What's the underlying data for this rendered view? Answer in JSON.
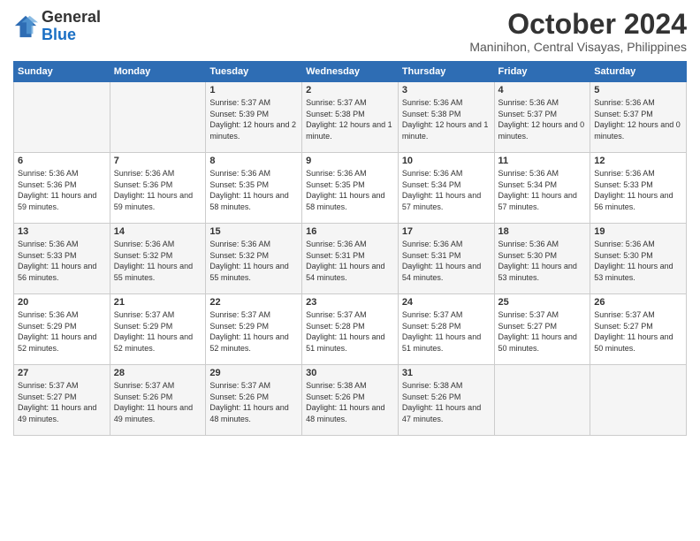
{
  "logo": {
    "line1": "General",
    "line2": "Blue"
  },
  "header": {
    "month": "October 2024",
    "location": "Maninihon, Central Visayas, Philippines"
  },
  "weekdays": [
    "Sunday",
    "Monday",
    "Tuesday",
    "Wednesday",
    "Thursday",
    "Friday",
    "Saturday"
  ],
  "weeks": [
    [
      {
        "day": "",
        "sunrise": "",
        "sunset": "",
        "daylight": ""
      },
      {
        "day": "",
        "sunrise": "",
        "sunset": "",
        "daylight": ""
      },
      {
        "day": "1",
        "sunrise": "Sunrise: 5:37 AM",
        "sunset": "Sunset: 5:39 PM",
        "daylight": "Daylight: 12 hours and 2 minutes."
      },
      {
        "day": "2",
        "sunrise": "Sunrise: 5:37 AM",
        "sunset": "Sunset: 5:38 PM",
        "daylight": "Daylight: 12 hours and 1 minute."
      },
      {
        "day": "3",
        "sunrise": "Sunrise: 5:36 AM",
        "sunset": "Sunset: 5:38 PM",
        "daylight": "Daylight: 12 hours and 1 minute."
      },
      {
        "day": "4",
        "sunrise": "Sunrise: 5:36 AM",
        "sunset": "Sunset: 5:37 PM",
        "daylight": "Daylight: 12 hours and 0 minutes."
      },
      {
        "day": "5",
        "sunrise": "Sunrise: 5:36 AM",
        "sunset": "Sunset: 5:37 PM",
        "daylight": "Daylight: 12 hours and 0 minutes."
      }
    ],
    [
      {
        "day": "6",
        "sunrise": "Sunrise: 5:36 AM",
        "sunset": "Sunset: 5:36 PM",
        "daylight": "Daylight: 11 hours and 59 minutes."
      },
      {
        "day": "7",
        "sunrise": "Sunrise: 5:36 AM",
        "sunset": "Sunset: 5:36 PM",
        "daylight": "Daylight: 11 hours and 59 minutes."
      },
      {
        "day": "8",
        "sunrise": "Sunrise: 5:36 AM",
        "sunset": "Sunset: 5:35 PM",
        "daylight": "Daylight: 11 hours and 58 minutes."
      },
      {
        "day": "9",
        "sunrise": "Sunrise: 5:36 AM",
        "sunset": "Sunset: 5:35 PM",
        "daylight": "Daylight: 11 hours and 58 minutes."
      },
      {
        "day": "10",
        "sunrise": "Sunrise: 5:36 AM",
        "sunset": "Sunset: 5:34 PM",
        "daylight": "Daylight: 11 hours and 57 minutes."
      },
      {
        "day": "11",
        "sunrise": "Sunrise: 5:36 AM",
        "sunset": "Sunset: 5:34 PM",
        "daylight": "Daylight: 11 hours and 57 minutes."
      },
      {
        "day": "12",
        "sunrise": "Sunrise: 5:36 AM",
        "sunset": "Sunset: 5:33 PM",
        "daylight": "Daylight: 11 hours and 56 minutes."
      }
    ],
    [
      {
        "day": "13",
        "sunrise": "Sunrise: 5:36 AM",
        "sunset": "Sunset: 5:33 PM",
        "daylight": "Daylight: 11 hours and 56 minutes."
      },
      {
        "day": "14",
        "sunrise": "Sunrise: 5:36 AM",
        "sunset": "Sunset: 5:32 PM",
        "daylight": "Daylight: 11 hours and 55 minutes."
      },
      {
        "day": "15",
        "sunrise": "Sunrise: 5:36 AM",
        "sunset": "Sunset: 5:32 PM",
        "daylight": "Daylight: 11 hours and 55 minutes."
      },
      {
        "day": "16",
        "sunrise": "Sunrise: 5:36 AM",
        "sunset": "Sunset: 5:31 PM",
        "daylight": "Daylight: 11 hours and 54 minutes."
      },
      {
        "day": "17",
        "sunrise": "Sunrise: 5:36 AM",
        "sunset": "Sunset: 5:31 PM",
        "daylight": "Daylight: 11 hours and 54 minutes."
      },
      {
        "day": "18",
        "sunrise": "Sunrise: 5:36 AM",
        "sunset": "Sunset: 5:30 PM",
        "daylight": "Daylight: 11 hours and 53 minutes."
      },
      {
        "day": "19",
        "sunrise": "Sunrise: 5:36 AM",
        "sunset": "Sunset: 5:30 PM",
        "daylight": "Daylight: 11 hours and 53 minutes."
      }
    ],
    [
      {
        "day": "20",
        "sunrise": "Sunrise: 5:36 AM",
        "sunset": "Sunset: 5:29 PM",
        "daylight": "Daylight: 11 hours and 52 minutes."
      },
      {
        "day": "21",
        "sunrise": "Sunrise: 5:37 AM",
        "sunset": "Sunset: 5:29 PM",
        "daylight": "Daylight: 11 hours and 52 minutes."
      },
      {
        "day": "22",
        "sunrise": "Sunrise: 5:37 AM",
        "sunset": "Sunset: 5:29 PM",
        "daylight": "Daylight: 11 hours and 52 minutes."
      },
      {
        "day": "23",
        "sunrise": "Sunrise: 5:37 AM",
        "sunset": "Sunset: 5:28 PM",
        "daylight": "Daylight: 11 hours and 51 minutes."
      },
      {
        "day": "24",
        "sunrise": "Sunrise: 5:37 AM",
        "sunset": "Sunset: 5:28 PM",
        "daylight": "Daylight: 11 hours and 51 minutes."
      },
      {
        "day": "25",
        "sunrise": "Sunrise: 5:37 AM",
        "sunset": "Sunset: 5:27 PM",
        "daylight": "Daylight: 11 hours and 50 minutes."
      },
      {
        "day": "26",
        "sunrise": "Sunrise: 5:37 AM",
        "sunset": "Sunset: 5:27 PM",
        "daylight": "Daylight: 11 hours and 50 minutes."
      }
    ],
    [
      {
        "day": "27",
        "sunrise": "Sunrise: 5:37 AM",
        "sunset": "Sunset: 5:27 PM",
        "daylight": "Daylight: 11 hours and 49 minutes."
      },
      {
        "day": "28",
        "sunrise": "Sunrise: 5:37 AM",
        "sunset": "Sunset: 5:26 PM",
        "daylight": "Daylight: 11 hours and 49 minutes."
      },
      {
        "day": "29",
        "sunrise": "Sunrise: 5:37 AM",
        "sunset": "Sunset: 5:26 PM",
        "daylight": "Daylight: 11 hours and 48 minutes."
      },
      {
        "day": "30",
        "sunrise": "Sunrise: 5:38 AM",
        "sunset": "Sunset: 5:26 PM",
        "daylight": "Daylight: 11 hours and 48 minutes."
      },
      {
        "day": "31",
        "sunrise": "Sunrise: 5:38 AM",
        "sunset": "Sunset: 5:26 PM",
        "daylight": "Daylight: 11 hours and 47 minutes."
      },
      {
        "day": "",
        "sunrise": "",
        "sunset": "",
        "daylight": ""
      },
      {
        "day": "",
        "sunrise": "",
        "sunset": "",
        "daylight": ""
      }
    ]
  ]
}
